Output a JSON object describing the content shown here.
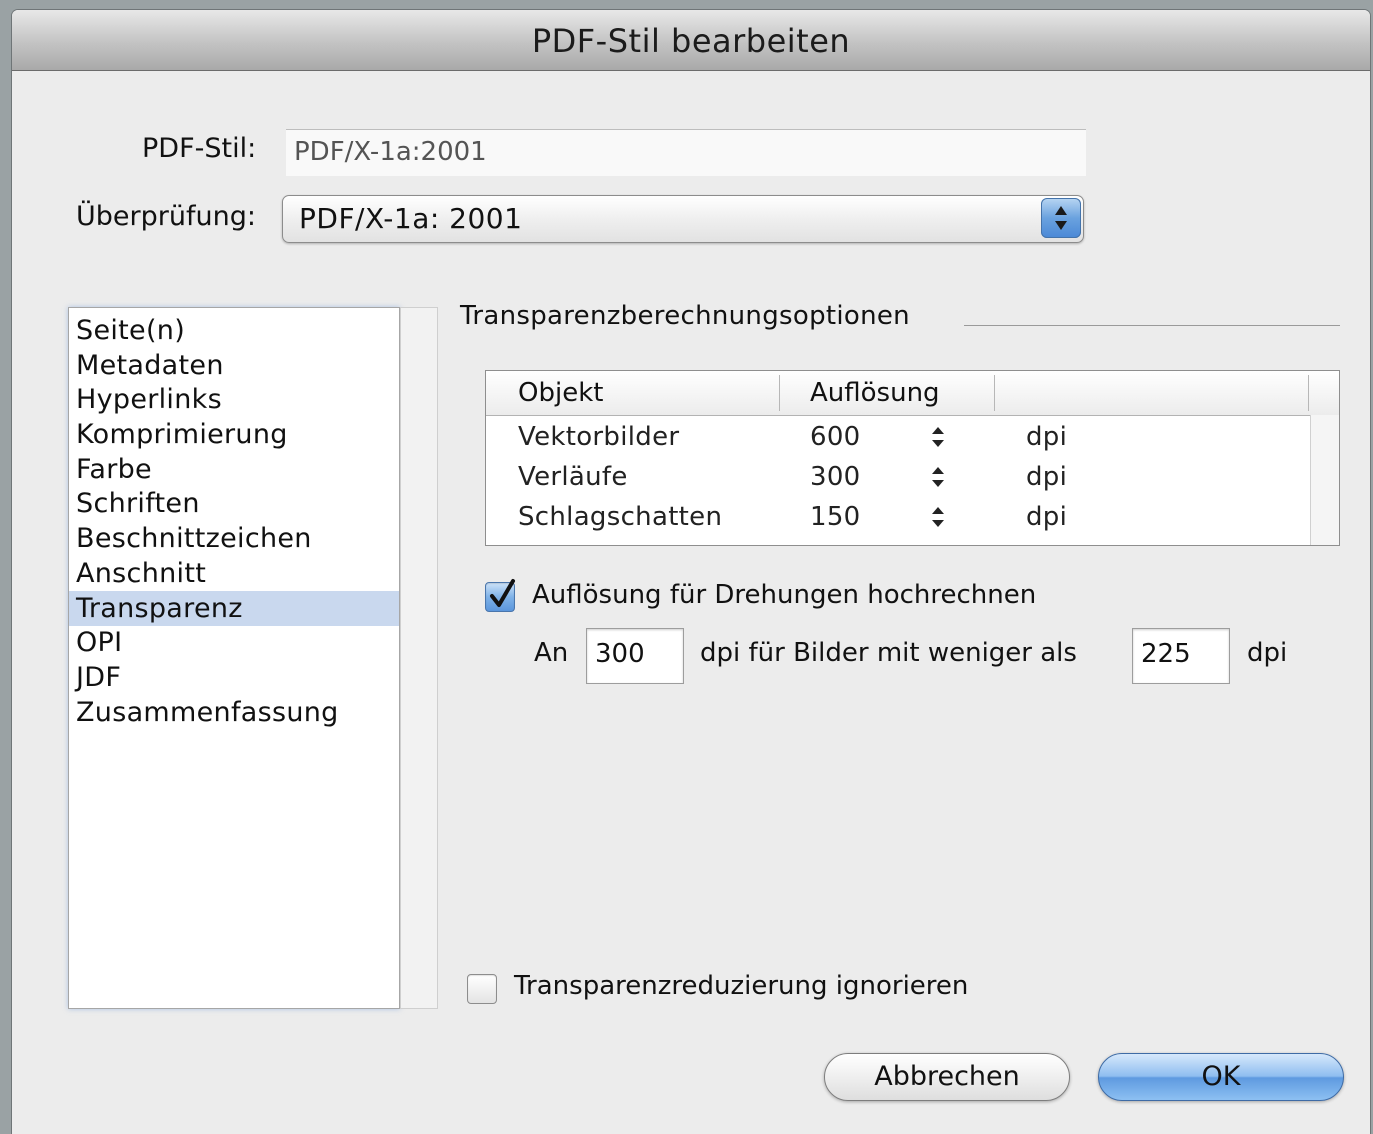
{
  "window": {
    "title": "PDF-Stil bearbeiten"
  },
  "form": {
    "pdf_stil_label": "PDF-Stil:",
    "pdf_stil_value": "PDF/X-1a:2001",
    "ueberpruefung_label": "Überprüfung:",
    "ueberpruefung_value": "PDF/X-1a: 2001"
  },
  "sidebar": {
    "items": [
      {
        "label": "Seite(n)"
      },
      {
        "label": "Metadaten"
      },
      {
        "label": "Hyperlinks"
      },
      {
        "label": "Komprimierung"
      },
      {
        "label": "Farbe"
      },
      {
        "label": "Schriften"
      },
      {
        "label": "Beschnittzeichen"
      },
      {
        "label": "Anschnitt"
      },
      {
        "label": "Transparenz"
      },
      {
        "label": "OPI"
      },
      {
        "label": "JDF"
      },
      {
        "label": "Zusammenfassung"
      }
    ],
    "selected": "Transparenz"
  },
  "panel": {
    "group_title": "Transparenzberechnungsoptionen",
    "table": {
      "headers": [
        "Objekt",
        "Auflösung"
      ],
      "rows": [
        {
          "object": "Vektorbilder",
          "resolution": "600",
          "unit": "dpi"
        },
        {
          "object": "Verläufe",
          "resolution": "300",
          "unit": "dpi"
        },
        {
          "object": "Schlagschatten",
          "resolution": "150",
          "unit": "dpi"
        }
      ]
    },
    "upsample": {
      "label": "Auflösung für Drehungen hochrechnen",
      "checked": true,
      "an_label": "An",
      "target_dpi": "300",
      "middle_text": "dpi für Bilder mit weniger als",
      "threshold_dpi": "225",
      "unit": "dpi"
    },
    "ignore": {
      "label": "Transparenzreduzierung ignorieren",
      "checked": false
    }
  },
  "buttons": {
    "cancel": "Abbrechen",
    "ok": "OK"
  },
  "colors": {
    "selection": "#c9d8ee",
    "aqua_blue": "#5e9ae0",
    "window_bg": "#ececec"
  }
}
